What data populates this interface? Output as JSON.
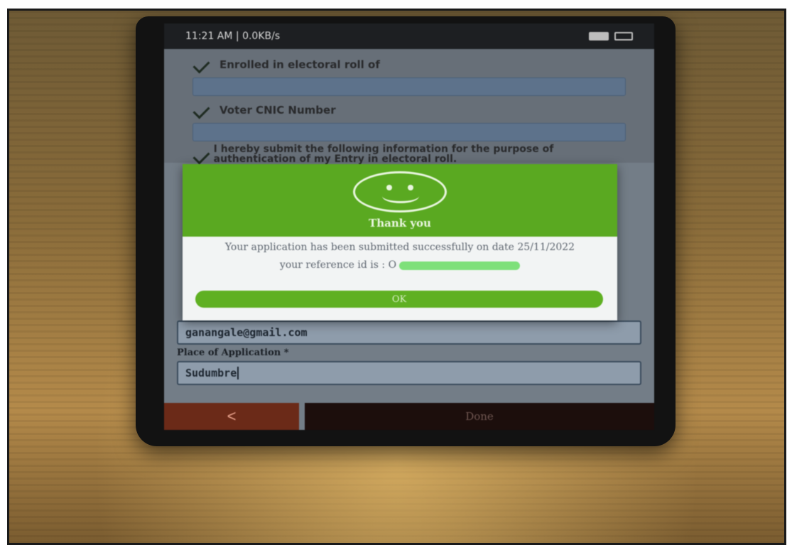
{
  "status_bar": {
    "time_speed": "11:21 AM | 0.0KB/s"
  },
  "form": {
    "enrolled_label": "Enrolled in electoral roll of",
    "enrolled_value": "",
    "voter_cnic_label": "Voter CNIC Number",
    "voter_cnic_value": "",
    "declaration": "I hereby submit the following information for the purpose of authentication of my Entry in electoral roll.",
    "email_value": "ganangale@gmail.com",
    "place_label": "Place of Application *",
    "place_value": "Sudumbre"
  },
  "modal": {
    "title": "Thank you",
    "message": "Your application has been submitted successfully on date 25/11/2022",
    "reference_prefix": "your reference id is : O",
    "ok_label": "OK"
  },
  "nav": {
    "back_label": "<",
    "done_label": "Done"
  }
}
